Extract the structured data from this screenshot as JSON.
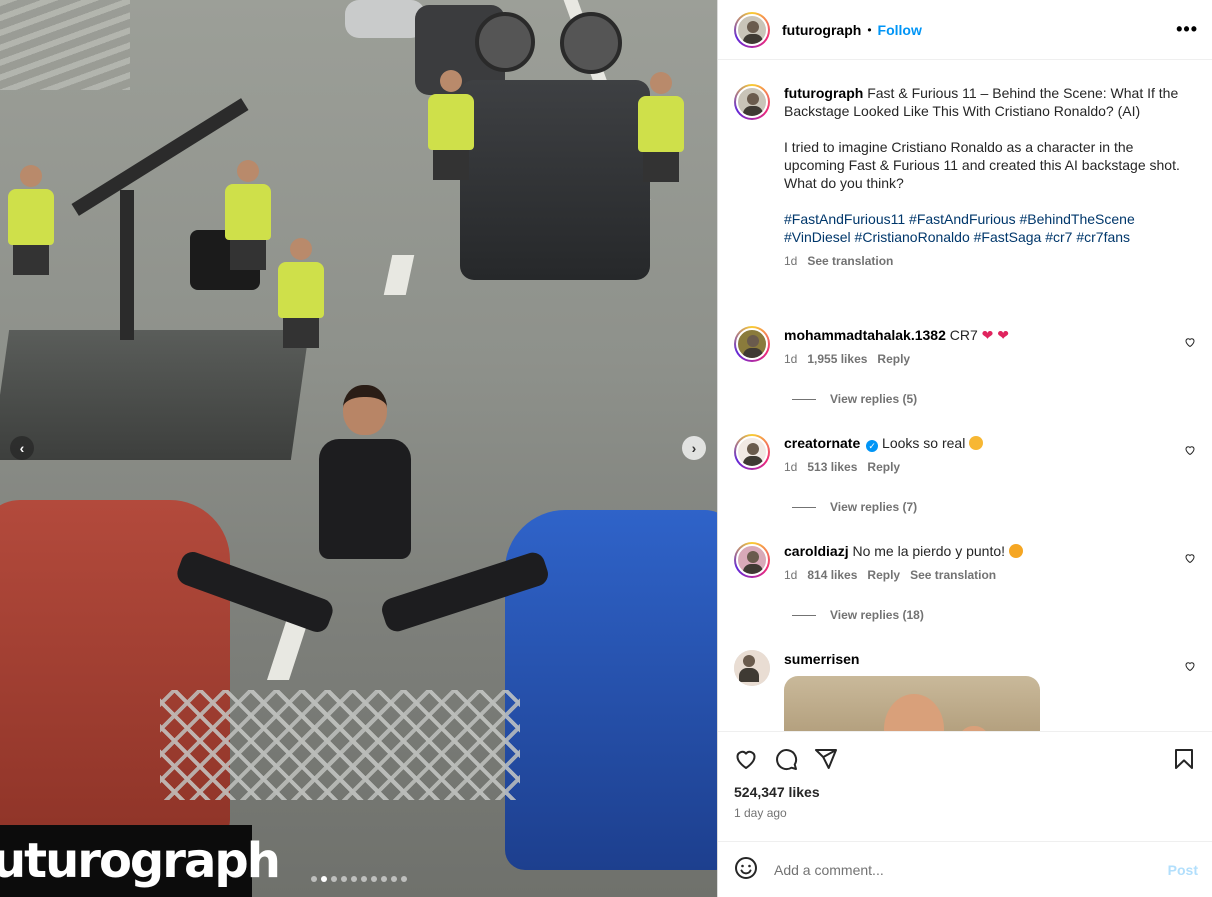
{
  "post": {
    "username": "futurograph",
    "follow_label": "Follow",
    "separator": "•",
    "more_label": "•••",
    "watermark": "futurograph",
    "carousel": {
      "total_slides": 10,
      "active_index": 1
    },
    "caption": {
      "title": "Fast & Furious 11 – Behind the Scene: What If the Backstage Looked Like This With Cristiano Ronaldo? (AI)",
      "body": "I tried to imagine Cristiano Ronaldo as a character in the upcoming Fast & Furious 11 and created this AI backstage shot. What do you think?",
      "hashtags": "#FastAndFurious11 #FastAndFurious #BehindTheScene #VinDiesel #CristianoRonaldo #FastSaga #cr7 #cr7fans",
      "time": "1d",
      "see_translation": "See translation"
    },
    "comments": [
      {
        "username": "mohammadtahalak.1382",
        "text": "CR7 ",
        "hearts": "❤ ❤",
        "time": "1d",
        "likes": "1,955 likes",
        "reply": "Reply",
        "view_replies": "View replies (5)"
      },
      {
        "username": "creatornate",
        "verified": "✓",
        "text": "Looks so real",
        "time": "1d",
        "likes": "513 likes",
        "reply": "Reply",
        "view_replies": "View replies (7)"
      },
      {
        "username": "caroldiazj",
        "text": "No me la pierdo y punto!",
        "time": "1d",
        "likes": "814 likes",
        "reply": "Reply",
        "see_translation": "See translation",
        "view_replies": "View replies (18)"
      },
      {
        "username": "sumerrisen"
      }
    ],
    "likes": "524,347 likes",
    "posted": "1 day ago",
    "add_comment_placeholder": "Add a comment...",
    "post_label": "Post"
  },
  "colors": {
    "accent": "#0095f6",
    "hashtag": "#00376b",
    "muted": "#737373",
    "post_disabled": "#b2dffc"
  },
  "icons": [
    "chevron-left-icon",
    "chevron-right-icon",
    "more-icon",
    "heart-icon",
    "comment-icon",
    "share-icon",
    "bookmark-icon",
    "emoji-icon",
    "verified-icon"
  ]
}
